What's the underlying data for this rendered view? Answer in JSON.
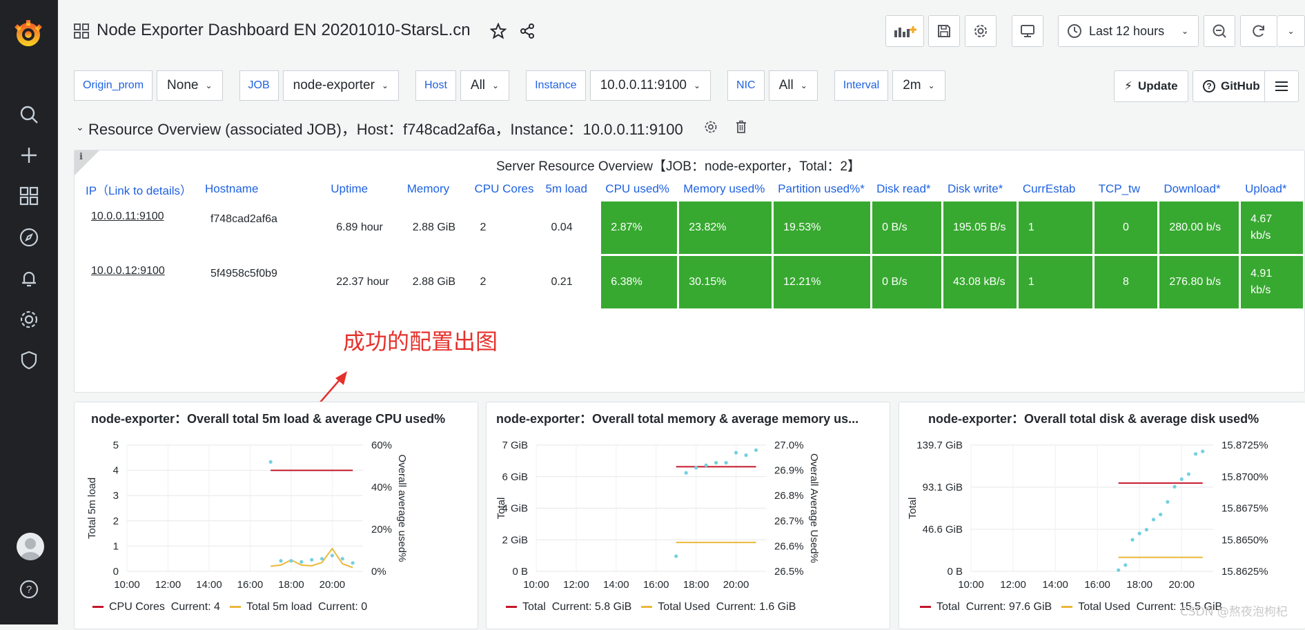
{
  "sidebar": {
    "items": [
      "search-icon",
      "plus-icon",
      "dashboards-icon",
      "explore-icon",
      "alerting-icon",
      "configuration-icon",
      "server-admin-icon"
    ]
  },
  "header": {
    "title": "Node Exporter Dashboard EN 20201010-StarsL.cn",
    "time_range": "Last 12 hours"
  },
  "variables": [
    {
      "label": "Origin_prom",
      "value": "None"
    },
    {
      "label": "JOB",
      "value": "node-exporter"
    },
    {
      "label": "Host",
      "value": "All"
    },
    {
      "label": "Instance",
      "value": "10.0.0.11:9100"
    },
    {
      "label": "NIC",
      "value": "All"
    },
    {
      "label": "Interval",
      "value": "2m"
    }
  ],
  "links": {
    "update": "Update",
    "github": "GitHub"
  },
  "row": {
    "title": "Resource Overview (associated JOB)，Host：f748cad2af6a，Instance：10.0.0.11:9100"
  },
  "server_table": {
    "title": "Server Resource Overview【JOB：node-exporter，Total：2】",
    "info_icon": "i",
    "columns": [
      "IP（Link to details）",
      "Hostname",
      "Uptime",
      "Memory",
      "CPU Cores",
      "5m load",
      "CPU used%",
      "Memory used%",
      "Partition used%*",
      "Disk read*",
      "Disk write*",
      "CurrEstab",
      "TCP_tw",
      "Download*",
      "Upload*"
    ],
    "rows": [
      {
        "ip": "10.0.0.11:9100",
        "hostname": "f748cad2af6a",
        "uptime": "6.89 hour",
        "memory": "2.88 GiB",
        "cores": "2",
        "load5": "0.04",
        "cpu": "2.87%",
        "mem": "23.82%",
        "part": "19.53%",
        "dread": "0 B/s",
        "dwrite": "195.05 B/s",
        "estab": "1",
        "tcptw": "0",
        "down": "280.00 b/s",
        "up": "4.67 kb/s"
      },
      {
        "ip": "10.0.0.12:9100",
        "hostname": "5f4958c5f0b9",
        "uptime": "22.37 hour",
        "memory": "2.88 GiB",
        "cores": "2",
        "load5": "0.21",
        "cpu": "6.38%",
        "mem": "30.15%",
        "part": "12.21%",
        "dread": "0 B/s",
        "dwrite": "43.08 kB/s",
        "estab": "1",
        "tcptw": "8",
        "down": "276.80 b/s",
        "up": "4.91 kb/s"
      }
    ]
  },
  "annotation": "成功的配置出图",
  "watermark": "CSDN @熬夜泡枸杞",
  "colors": {
    "green": "#37a930",
    "red": "#c4162a",
    "yellow": "#eab839",
    "cyan": "#73d0e0",
    "link": "#1f62e0"
  },
  "chart_data": [
    {
      "type": "line",
      "title": "node-exporter：Overall total 5m load & average CPU used%",
      "x_ticks": [
        "10:00",
        "12:00",
        "14:00",
        "16:00",
        "18:00",
        "20:00"
      ],
      "ylabel": "Total 5m load",
      "ylabel_right": "Overall average used%",
      "y_ticks": [
        "0",
        "1",
        "2",
        "3",
        "4",
        "5"
      ],
      "y_ticks_right": [
        "0%",
        "20%",
        "40%",
        "60%"
      ],
      "ylim": [
        0,
        5
      ],
      "legend": [
        {
          "name": "CPU Cores",
          "current_label": "Current: 4"
        },
        {
          "name": "Total 5m load",
          "current_label": "Current: 0"
        }
      ],
      "series": [
        {
          "name": "CPU Cores",
          "x": [
            "17:00",
            "21:00"
          ],
          "values": [
            4,
            4
          ]
        },
        {
          "name": "Total 5m load",
          "x": [
            "17:00",
            "17:30",
            "18:00",
            "18:30",
            "19:00",
            "19:30",
            "20:00",
            "20:30",
            "21:00"
          ],
          "values": [
            0.2,
            0.25,
            0.45,
            0.25,
            0.22,
            0.35,
            0.9,
            0.3,
            0.15
          ]
        },
        {
          "x": [
            "17:00",
            "17:30",
            "18:00",
            "18:30",
            "19:00",
            "19:30",
            "20:00",
            "20:30",
            "21:00"
          ],
          "values": [
            52,
            5,
            5,
            4.5,
            5.5,
            6,
            7.5,
            6,
            4
          ]
        }
      ]
    },
    {
      "type": "line",
      "title": "node-exporter：Overall total memory & average memory us...",
      "x_ticks": [
        "10:00",
        "12:00",
        "14:00",
        "16:00",
        "18:00",
        "20:00"
      ],
      "ylabel": "Total",
      "ylabel_right": "Overall Average Used%",
      "y_ticks": [
        "0 B",
        "2 GiB",
        "4 GiB",
        "6 GiB",
        "7 GiB"
      ],
      "y_ticks_right": [
        "26.5%",
        "26.6%",
        "26.7%",
        "26.8%",
        "26.9%",
        "27.0%"
      ],
      "legend": [
        {
          "name": "Total",
          "current_label": "Current: 5.8 GiB"
        },
        {
          "name": "Total Used",
          "current_label": "Current: 1.6 GiB"
        }
      ],
      "series": [
        {
          "name": "Total",
          "x": [
            "17:00",
            "21:00"
          ],
          "values": [
            5.8,
            5.8
          ]
        },
        {
          "name": "Total Used",
          "x": [
            "17:00",
            "21:00"
          ],
          "values": [
            1.6,
            1.6
          ]
        },
        {
          "x": [
            "17:00",
            "17:30",
            "18:00",
            "18:30",
            "19:00",
            "19:30",
            "20:00",
            "20:30",
            "21:00"
          ],
          "values": [
            26.56,
            26.89,
            26.91,
            26.92,
            26.93,
            26.93,
            26.97,
            26.96,
            26.98
          ]
        }
      ]
    },
    {
      "type": "line",
      "title": "node-exporter：Overall total disk & average disk used%",
      "x_ticks": [
        "10:00",
        "12:00",
        "14:00",
        "16:00",
        "18:00",
        "20:00"
      ],
      "ylabel": "Total",
      "y_ticks": [
        "0 B",
        "46.6 GiB",
        "93.1 GiB",
        "139.7 GiB"
      ],
      "y_ticks_right": [
        "15.8625%",
        "15.8650%",
        "15.8675%",
        "15.8700%",
        "15.8725%"
      ],
      "legend": [
        {
          "name": "Total",
          "current_label": "Current: 97.6 GiB"
        },
        {
          "name": "Total Used",
          "current_label": "Current: 15.5 GiB"
        }
      ],
      "series": [
        {
          "name": "Total",
          "x": [
            "17:00",
            "21:00"
          ],
          "values": [
            97.6,
            97.6
          ]
        },
        {
          "name": "Total Used",
          "x": [
            "17:00",
            "21:00"
          ],
          "values": [
            15.5,
            15.5
          ]
        },
        {
          "x": [
            "17:00",
            "17:20",
            "17:40",
            "18:00",
            "18:20",
            "18:40",
            "19:00",
            "19:20",
            "19:40",
            "20:00",
            "20:20",
            "20:40",
            "21:00"
          ],
          "values": [
            15.8626,
            15.863,
            15.865,
            15.8655,
            15.8658,
            15.8666,
            15.867,
            15.868,
            15.8692,
            15.8698,
            15.8702,
            15.8718,
            15.872
          ]
        }
      ]
    }
  ]
}
